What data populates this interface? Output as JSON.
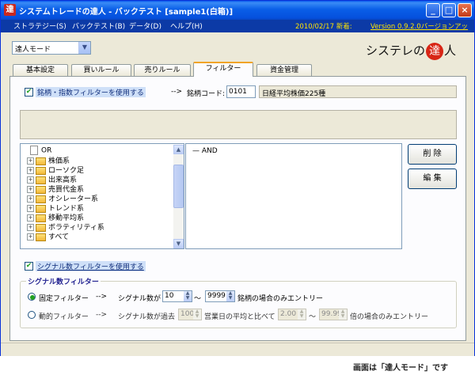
{
  "window": {
    "title": "システムトレードの達人 - バックテスト [sample1(白箱)]",
    "app_icon_glyph": "達",
    "minimize_glyph": "_",
    "maximize_glyph": "□",
    "close_glyph": "×"
  },
  "menu": {
    "items": [
      "ストラテジー(S)",
      "バックテスト(B)",
      "データ(D)",
      "ヘルプ(H)"
    ],
    "date_text": "2010/02/17 新着:",
    "version_link": "Version 0.9.2.0バージョンアッ"
  },
  "mode_select": {
    "value": "達人モード",
    "arrow": "▼"
  },
  "logo": {
    "prefix": "システレの",
    "mark": "達",
    "suffix": "人"
  },
  "tabs": [
    {
      "label": "基本設定",
      "active": false
    },
    {
      "label": "買いルール",
      "active": false
    },
    {
      "label": "売りルール",
      "active": false
    },
    {
      "label": "フィルター",
      "active": true
    },
    {
      "label": "資金管理",
      "active": false
    }
  ],
  "filter": {
    "use_brand_index_label": "銘柄・指数フィルターを使用する",
    "checked_mark": "✔",
    "arrow": "-->",
    "code_label": "銘柄コード:",
    "code_value": "0101",
    "code_name": "日経平均株価225種"
  },
  "tree": {
    "root": "OR",
    "nodes": [
      "株価系",
      "ローソク足",
      "出来高系",
      "売買代金系",
      "オシレーター系",
      "トレンド系",
      "移動平均系",
      "ボラティリティ系",
      "すべて"
    ],
    "expand_glyph": "+",
    "scroll_up": "▲",
    "scroll_down": "▼"
  },
  "rule": {
    "root": "AND"
  },
  "buttons": {
    "delete": "削 除",
    "edit": "編 集"
  },
  "signal": {
    "use_label": "シグナル数フィルターを使用する",
    "group_title": "シグナル数フィルター",
    "fixed": {
      "label": "固定フィルター",
      "arrow": "-->",
      "prefix": "シグナル数が",
      "min": "10",
      "tilde": "〜",
      "max": "9999",
      "suffix": "銘柄の場合のみエントリー"
    },
    "dynamic": {
      "label": "動的フィルター",
      "arrow": "-->",
      "prefix": "シグナル数が過去",
      "days": "100",
      "mid": "営業日の平均と比べて",
      "min": "2.00",
      "tilde": "〜",
      "max": "99.99",
      "suffix": "倍の場合のみエントリー"
    }
  },
  "caption": "画面は「達人モード」です"
}
